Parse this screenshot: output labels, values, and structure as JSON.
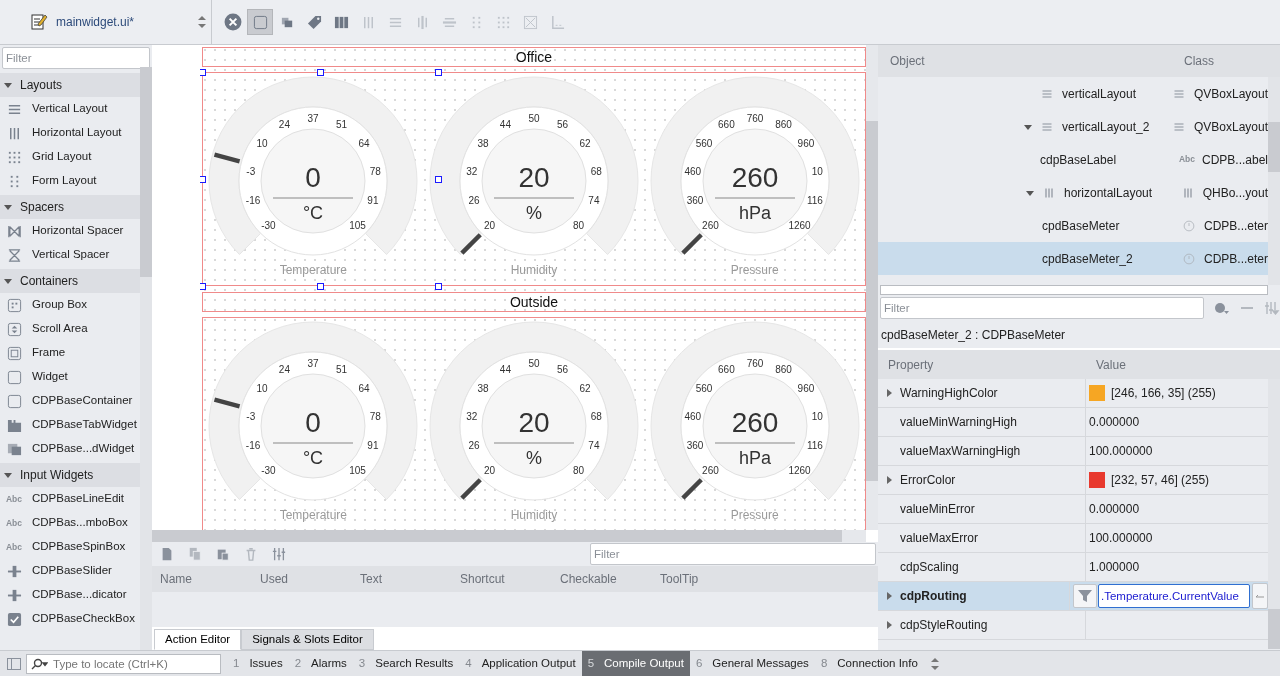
{
  "editor_bar": {
    "file_name": "mainwidget.ui*"
  },
  "toolbar": [
    {
      "kind": "close",
      "pressed": false,
      "disabled": false
    },
    {
      "kind": "widget",
      "pressed": true,
      "disabled": false
    },
    {
      "kind": "buddy",
      "pressed": false,
      "disabled": false
    },
    {
      "kind": "tag",
      "pressed": false,
      "disabled": false
    },
    {
      "kind": "hsplit",
      "pressed": false,
      "disabled": false
    },
    {
      "kind": "hlayout",
      "pressed": false,
      "disabled": true
    },
    {
      "kind": "vlayout",
      "pressed": false,
      "disabled": true
    },
    {
      "kind": "hsplit2",
      "pressed": false,
      "disabled": true
    },
    {
      "kind": "vsplit",
      "pressed": false,
      "disabled": true
    },
    {
      "kind": "form",
      "pressed": false,
      "disabled": true
    },
    {
      "kind": "grid",
      "pressed": false,
      "disabled": true
    },
    {
      "kind": "break",
      "pressed": false,
      "disabled": true
    },
    {
      "kind": "adjust",
      "pressed": false,
      "disabled": true
    }
  ],
  "widget_box": {
    "filter": {
      "placeholder": "Filter"
    },
    "categories": [
      {
        "title": "Layouts",
        "expanded": true,
        "items": [
          {
            "label": "Vertical Layout",
            "kind": "vlayout"
          },
          {
            "label": "Horizontal Layout",
            "kind": "hlayout"
          },
          {
            "label": "Grid Layout",
            "kind": "grid"
          },
          {
            "label": "Form Layout",
            "kind": "form"
          }
        ]
      },
      {
        "title": "Spacers",
        "expanded": true,
        "items": [
          {
            "label": "Horizontal Spacer",
            "kind": "hspacer"
          },
          {
            "label": "Vertical Spacer",
            "kind": "vspacer"
          }
        ]
      },
      {
        "title": "Containers",
        "expanded": true,
        "items": [
          {
            "label": "Group Box",
            "kind": "groupbox"
          },
          {
            "label": "Scroll Area",
            "kind": "scrollarea"
          },
          {
            "label": "Frame",
            "kind": "frame"
          },
          {
            "label": "Widget",
            "kind": "widget"
          },
          {
            "label": "CDPBaseContainer",
            "kind": "widget"
          },
          {
            "label": "CDPBaseTabWidget",
            "kind": "tabwidget"
          },
          {
            "label": "CDPBase...dWidget",
            "kind": "stacked"
          }
        ]
      },
      {
        "title": "Input Widgets",
        "expanded": true,
        "items": [
          {
            "label": "CDPBaseLineEdit",
            "kind": "abc",
            "badge": "Abc"
          },
          {
            "label": "CDPBas...mboBox",
            "kind": "abc",
            "badge": "Abc"
          },
          {
            "label": "CDPBaseSpinBox",
            "kind": "abc",
            "badge": "Abc"
          },
          {
            "label": "CDPBaseSlider",
            "kind": "slider"
          },
          {
            "label": "CDPBase...dicator",
            "kind": "slider"
          },
          {
            "label": "CDPBaseCheckBox",
            "kind": "checkbox"
          }
        ]
      }
    ]
  },
  "form": {
    "groups": [
      {
        "title": "Office",
        "meters": [
          {
            "label": "Temperature",
            "value": "0",
            "unit": "°C",
            "ticks": [
              "-30",
              "-16",
              "-3",
              "10",
              "24",
              "37",
              "51",
              "64",
              "78",
              "91",
              "105"
            ]
          },
          {
            "label": "Humidity",
            "value": "20",
            "unit": "%",
            "ticks": [
              "20",
              "26",
              "32",
              "38",
              "44",
              "50",
              "56",
              "62",
              "68",
              "74",
              "80"
            ]
          },
          {
            "label": "Pressure",
            "value": "260",
            "unit": "hPa",
            "ticks": [
              "260",
              "360",
              "460",
              "560",
              "660",
              "760",
              "860",
              "960",
              "10",
              "116",
              "1260"
            ]
          }
        ]
      },
      {
        "title": "Outside",
        "meters": [
          {
            "label": "Temperature",
            "value": "0",
            "unit": "°C",
            "ticks": [
              "-30",
              "-16",
              "-3",
              "10",
              "24",
              "37",
              "51",
              "64",
              "78",
              "91",
              "105"
            ]
          },
          {
            "label": "Humidity",
            "value": "20",
            "unit": "%",
            "ticks": [
              "20",
              "26",
              "32",
              "38",
              "44",
              "50",
              "56",
              "62",
              "68",
              "74",
              "80"
            ]
          },
          {
            "label": "Pressure",
            "value": "260",
            "unit": "hPa",
            "ticks": [
              "260",
              "360",
              "460",
              "560",
              "660",
              "760",
              "860",
              "960",
              "10",
              "116",
              "1260"
            ]
          }
        ]
      }
    ]
  },
  "action_editor": {
    "filter": {
      "placeholder": "Filter"
    },
    "columns": [
      "Name",
      "Used",
      "Text",
      "Shortcut",
      "Checkable",
      "ToolTip"
    ],
    "tabs": [
      {
        "label": "Action Editor",
        "selected": true
      },
      {
        "label": "Signals & Slots Editor",
        "selected": false
      }
    ]
  },
  "object_inspector": {
    "columns": [
      "Object",
      "Class"
    ],
    "items": [
      {
        "name": "verticalLayout",
        "class": "QVBoxLayout",
        "kind": "vlayout",
        "selected": false
      },
      {
        "name": "verticalLayout_2",
        "class": "QVBoxLayout",
        "kind": "vlayout",
        "selected": false,
        "expanded": true,
        "children": [
          {
            "name": "cdpBaseLabel",
            "class": "CDPB...abel",
            "kind": "label",
            "badge": "Abc",
            "selected": false
          },
          {
            "name": "horizontalLayout",
            "class": "QHBo...yout",
            "kind": "hlayout",
            "selected": false,
            "expanded": true,
            "children": [
              {
                "name": "cpdBaseMeter",
                "class": "CDPB...eter",
                "kind": "meter",
                "selected": false
              },
              {
                "name": "cpdBaseMeter_2",
                "class": "CDPB...eter",
                "kind": "meter",
                "selected": true
              }
            ]
          }
        ]
      }
    ]
  },
  "property_editor": {
    "filter": {
      "placeholder": "Filter"
    },
    "object_label": "cpdBaseMeter_2 : CDPBaseMeter",
    "columns": [
      "Property",
      "Value"
    ],
    "properties": [
      {
        "name": "WarningHighColor",
        "kind": "color",
        "value": "[246, 166, 35] (255)",
        "color": "#f6a623",
        "expandable": true,
        "changed": false,
        "selected": false
      },
      {
        "name": "valueMinWarningHigh",
        "kind": "text",
        "value": "0.000000",
        "expandable": false,
        "changed": false,
        "selected": false
      },
      {
        "name": "valueMaxWarningHigh",
        "kind": "text",
        "value": "100.000000",
        "expandable": false,
        "changed": false,
        "selected": false
      },
      {
        "name": "ErrorColor",
        "kind": "color",
        "value": "[232, 57, 46] (255)",
        "color": "#e8392e",
        "expandable": true,
        "changed": false,
        "selected": false
      },
      {
        "name": "valueMinError",
        "kind": "text",
        "value": "0.000000",
        "expandable": false,
        "changed": false,
        "selected": false
      },
      {
        "name": "valueMaxError",
        "kind": "text",
        "value": "100.000000",
        "expandable": false,
        "changed": false,
        "selected": false
      },
      {
        "name": "cdpScaling",
        "kind": "text",
        "value": "1.000000",
        "expandable": false,
        "changed": false,
        "selected": false
      },
      {
        "name": "cdpRouting",
        "kind": "routing",
        "value": ".Temperature.CurrentValue",
        "expandable": true,
        "changed": true,
        "selected": true
      },
      {
        "name": "cdpStyleRouting",
        "kind": "text",
        "expandable": true,
        "changed": false,
        "selected": false
      }
    ]
  },
  "status_bar": {
    "locate": {
      "placeholder": "Type to locate (Ctrl+K)"
    },
    "panes": [
      {
        "number": "1",
        "label": "Issues",
        "selected": false
      },
      {
        "number": "2",
        "label": "Alarms",
        "selected": false
      },
      {
        "number": "3",
        "label": "Search Results",
        "selected": false
      },
      {
        "number": "4",
        "label": "Application Output",
        "selected": false
      },
      {
        "number": "5",
        "label": "Compile Output",
        "selected": true
      },
      {
        "number": "6",
        "label": "General Messages",
        "selected": false
      },
      {
        "number": "8",
        "label": "Connection Info",
        "selected": false
      }
    ]
  }
}
